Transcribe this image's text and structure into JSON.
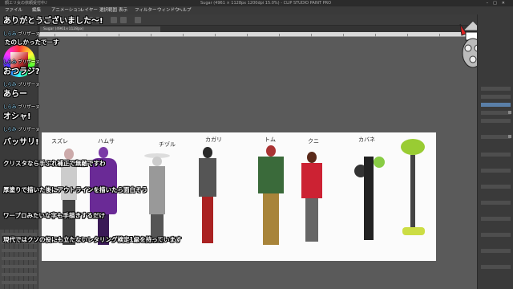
{
  "window": {
    "left_label": "顔エリ女の依頼受付中♪",
    "title": "Sugar (4961 × 1128px 1200dpi 15.0%) - CLIP STUDIO PAINT PRO"
  },
  "menu": {
    "items": [
      "ファイル",
      "編集",
      "アニメーション",
      "レイヤー",
      "選択範囲",
      "表示",
      "フィルター",
      "ウィンドウ",
      "ヘルプ"
    ]
  },
  "tab": {
    "label": "Sugar (4961×1128px)"
  },
  "canvas": {
    "names": [
      "スズレ",
      "ハムサ",
      "チヅル",
      "カガリ",
      "トム",
      "クニ",
      "カバネ"
    ]
  },
  "chat": {
    "user_tag": "しらみ",
    "user_name": "ブリザーヌ",
    "messages": [
      "ありがとうございました～!",
      "たのしかったでーす",
      "おつラジ?",
      "あらー",
      "オシャ!",
      "バッサリ!",
      "クリスタなら手ぶれ補正で無敵ですわ",
      "厚塗りで描いた後にアウトラインを描いたら面白そう",
      "ワープロみたいな字も手描きするだけ",
      "現代ではクソの役にも立たないレタリング検定1級を持っています"
    ]
  },
  "colors": {
    "bg": "#4a4a4a",
    "panel": "#3a3a3a",
    "paper": "#fbfbfb",
    "selected_layer": "#5a7fa8",
    "comment_text": "#ffffff",
    "comment_outline": "#000000"
  }
}
